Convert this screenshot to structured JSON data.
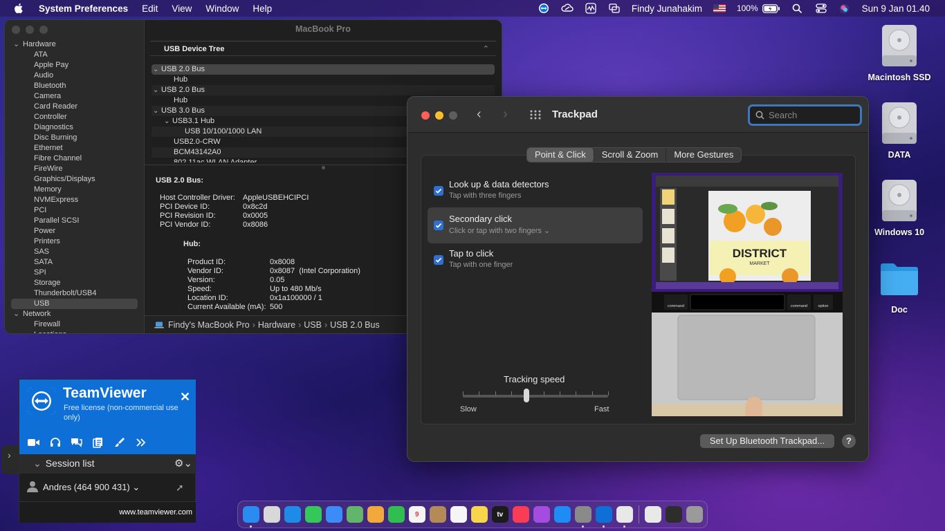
{
  "menubar": {
    "app_name": "System Preferences",
    "menus": [
      "Edit",
      "View",
      "Window",
      "Help"
    ],
    "user": "Findy Junahakim",
    "battery": "100%",
    "clock": "Sun 9 Jan  01.40",
    "status_icons": [
      "teamviewer-icon",
      "cloud-sync-icon",
      "activity-monitor-icon",
      "screen-mirror-icon",
      "flag-icon",
      "battery-icon",
      "search-icon",
      "control-center-icon",
      "siri-icon"
    ]
  },
  "sysinfo": {
    "title": "MacBook Pro",
    "sidebar": [
      {
        "label": "Hardware",
        "type": "cat"
      },
      {
        "label": "ATA",
        "type": "item"
      },
      {
        "label": "Apple Pay",
        "type": "item"
      },
      {
        "label": "Audio",
        "type": "item"
      },
      {
        "label": "Bluetooth",
        "type": "item"
      },
      {
        "label": "Camera",
        "type": "item"
      },
      {
        "label": "Card Reader",
        "type": "item"
      },
      {
        "label": "Controller",
        "type": "item"
      },
      {
        "label": "Diagnostics",
        "type": "item"
      },
      {
        "label": "Disc Burning",
        "type": "item"
      },
      {
        "label": "Ethernet",
        "type": "item"
      },
      {
        "label": "Fibre Channel",
        "type": "item"
      },
      {
        "label": "FireWire",
        "type": "item"
      },
      {
        "label": "Graphics/Displays",
        "type": "item"
      },
      {
        "label": "Memory",
        "type": "item"
      },
      {
        "label": "NVMExpress",
        "type": "item"
      },
      {
        "label": "PCI",
        "type": "item"
      },
      {
        "label": "Parallel SCSI",
        "type": "item"
      },
      {
        "label": "Power",
        "type": "item"
      },
      {
        "label": "Printers",
        "type": "item"
      },
      {
        "label": "SAS",
        "type": "item"
      },
      {
        "label": "SATA",
        "type": "item"
      },
      {
        "label": "SPI",
        "type": "item"
      },
      {
        "label": "Storage",
        "type": "item"
      },
      {
        "label": "Thunderbolt/USB4",
        "type": "item"
      },
      {
        "label": "USB",
        "type": "item",
        "selected": true
      },
      {
        "label": "Network",
        "type": "cat"
      },
      {
        "label": "Firewall",
        "type": "item"
      },
      {
        "label": "Locations",
        "type": "item"
      }
    ],
    "tree_header": "USB Device Tree",
    "usb_tree": [
      {
        "label": "USB 2.0 Bus",
        "level": 0,
        "arrow": true,
        "selected": true
      },
      {
        "label": "Hub",
        "level": 2,
        "arrow": false
      },
      {
        "label": "USB 2.0 Bus",
        "level": 0,
        "arrow": true
      },
      {
        "label": "Hub",
        "level": 2,
        "arrow": false
      },
      {
        "label": "USB 3.0 Bus",
        "level": 0,
        "arrow": true
      },
      {
        "label": "USB3.1 Hub",
        "level": 1,
        "arrow": true
      },
      {
        "label": "USB 10/100/1000 LAN",
        "level": 3,
        "arrow": false
      },
      {
        "label": "USB2.0-CRW",
        "level": 2,
        "arrow": false
      },
      {
        "label": "BCM43142A0",
        "level": 2,
        "arrow": false
      },
      {
        "label": "802.11ac WLAN Adapter",
        "level": 2,
        "arrow": false
      }
    ],
    "details": {
      "header": "USB 2.0 Bus:",
      "bus_props": [
        {
          "k": "Host Controller Driver:",
          "v": "AppleUSBEHCIPCI"
        },
        {
          "k": "PCI Device ID:",
          "v": "0x8c2d"
        },
        {
          "k": "PCI Revision ID:",
          "v": "0x0005"
        },
        {
          "k": "PCI Vendor ID:",
          "v": "0x8086"
        }
      ],
      "hub_header": "Hub:",
      "hub_props": [
        {
          "k": "Product ID:",
          "v": "0x8008"
        },
        {
          "k": "Vendor ID:",
          "v": "0x8087  (Intel Corporation)"
        },
        {
          "k": "Version:",
          "v": "0.05"
        },
        {
          "k": "Speed:",
          "v": "Up to 480 Mb/s"
        },
        {
          "k": "Location ID:",
          "v": "0x1a100000 / 1"
        },
        {
          "k": "Current Available (mA):",
          "v": "500"
        }
      ]
    },
    "breadcrumb": [
      "Findy's MacBook Pro",
      "Hardware",
      "USB",
      "USB 2.0 Bus"
    ]
  },
  "trackpad": {
    "title": "Trackpad",
    "search_placeholder": "Search",
    "tabs": [
      {
        "label": "Point & Click",
        "active": true
      },
      {
        "label": "Scroll & Zoom",
        "active": false
      },
      {
        "label": "More Gestures",
        "active": false
      }
    ],
    "options": [
      {
        "label": "Look up & data detectors",
        "sub": "Tap with three fingers",
        "checked": true,
        "selected": false
      },
      {
        "label": "Secondary click",
        "sub": "Click or tap with two fingers ⌄",
        "checked": true,
        "selected": true
      },
      {
        "label": "Tap to click",
        "sub": "Tap with one finger",
        "checked": true,
        "selected": false
      }
    ],
    "tracking_speed": {
      "label": "Tracking speed",
      "slow": "Slow",
      "fast": "Fast",
      "value": 0.44
    },
    "preview": {
      "poster_title": "DISTRICT",
      "poster_sub": "MARKET",
      "key_left": "command",
      "key_right": "command",
      "key_option": "option"
    },
    "bt_button": "Set Up Bluetooth Trackpad...",
    "help": "?"
  },
  "desktop": [
    {
      "name": "Macintosh SSD",
      "kind": "disk"
    },
    {
      "name": "DATA",
      "kind": "disk"
    },
    {
      "name": "Windows 10",
      "kind": "disk"
    },
    {
      "name": "Doc",
      "kind": "folder"
    }
  ],
  "teamviewer": {
    "brand": "TeamViewer",
    "license": "Free license (non-commercial use only)",
    "session_list": "Session list",
    "contact": "Andres (464 900 431)",
    "footer": "www.teamviewer.com"
  },
  "dock": {
    "apps": [
      {
        "name": "finder",
        "color": "#2a8cf0",
        "running": true
      },
      {
        "name": "launchpad",
        "color": "#d8d8d8",
        "running": false
      },
      {
        "name": "safari",
        "color": "#1f8be8",
        "running": false
      },
      {
        "name": "messages",
        "color": "#34c759",
        "running": false
      },
      {
        "name": "mail",
        "color": "#3b8cf7",
        "running": false
      },
      {
        "name": "maps",
        "color": "#62b56a",
        "running": false
      },
      {
        "name": "photos",
        "color": "#f2a93b",
        "running": false
      },
      {
        "name": "facetime",
        "color": "#2fbe4f",
        "running": false
      },
      {
        "name": "calendar",
        "color": "#f4f4f4",
        "label": "9",
        "running": false
      },
      {
        "name": "contacts",
        "color": "#b48a57",
        "running": false
      },
      {
        "name": "reminders",
        "color": "#f5f5f5",
        "running": false
      },
      {
        "name": "notes",
        "color": "#f6d64a",
        "running": false
      },
      {
        "name": "tv",
        "color": "#1b1b1b",
        "label": "tv",
        "running": false
      },
      {
        "name": "music",
        "color": "#fa3c56",
        "running": false
      },
      {
        "name": "podcasts",
        "color": "#a54ce0",
        "running": false
      },
      {
        "name": "app-store",
        "color": "#1d8cf5",
        "running": false
      },
      {
        "name": "system-preferences",
        "color": "#8a8a8a",
        "running": true
      },
      {
        "name": "teamviewer",
        "color": "#0e6fd6",
        "running": true
      },
      {
        "name": "system-information",
        "color": "#e8e8e8",
        "running": true
      }
    ],
    "others": [
      {
        "name": "document",
        "color": "#e9e9e9"
      },
      {
        "name": "screenshot",
        "color": "#2d2d2d"
      },
      {
        "name": "trash",
        "color": "#9a9a9a"
      }
    ]
  }
}
